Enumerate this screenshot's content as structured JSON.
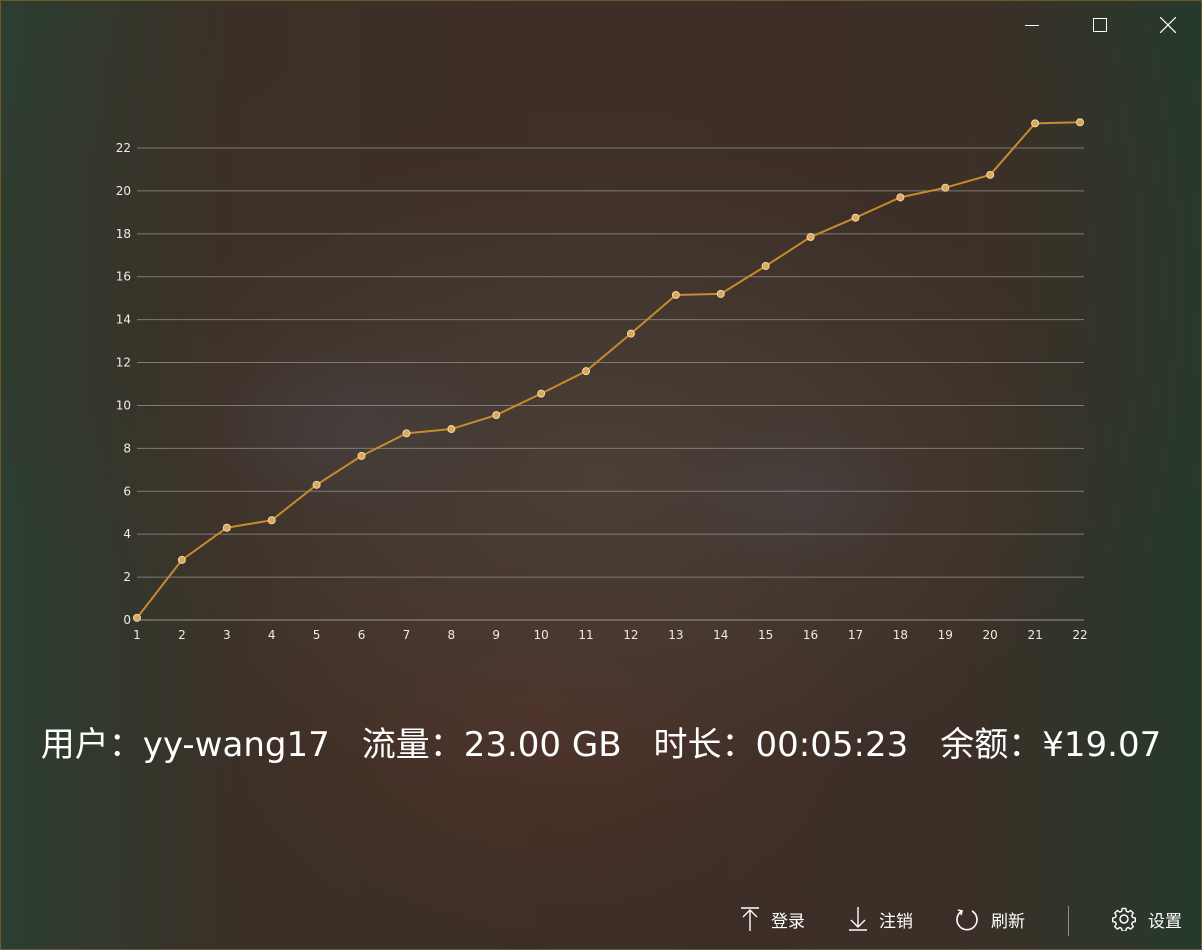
{
  "window_controls": {
    "minimize_icon": "minimize-icon",
    "maximize_icon": "maximize-icon",
    "close_icon": "close-icon"
  },
  "chart_data": {
    "type": "line",
    "x": [
      1,
      2,
      3,
      4,
      5,
      6,
      7,
      8,
      9,
      10,
      11,
      12,
      13,
      14,
      15,
      16,
      17,
      18,
      19,
      20,
      21,
      22
    ],
    "values": [
      0.1,
      2.8,
      4.3,
      4.65,
      6.3,
      7.65,
      8.7,
      8.9,
      9.55,
      10.55,
      11.6,
      13.35,
      15.15,
      15.2,
      16.5,
      17.85,
      18.75,
      19.7,
      20.15,
      20.75,
      23.15,
      23.2
    ],
    "xticks": [
      "1",
      "2",
      "3",
      "4",
      "5",
      "6",
      "7",
      "8",
      "9",
      "10",
      "11",
      "12",
      "13",
      "14",
      "15",
      "16",
      "17",
      "18",
      "19",
      "20",
      "21",
      "22"
    ],
    "yticks": [
      "0",
      "2",
      "4",
      "6",
      "8",
      "10",
      "12",
      "14",
      "16",
      "18",
      "20",
      "22"
    ],
    "ylim": [
      0,
      22
    ],
    "grid": true,
    "legend": "none",
    "line_color": "#c88a2e",
    "marker_fill": "#d9a85a"
  },
  "info": {
    "user": "用户：yy-wang17",
    "traffic": "流量：23.00 GB",
    "duration": "时长：00:05:23",
    "balance": "余额：¥19.07"
  },
  "toolbar": {
    "login_label": "登录",
    "logout_label": "注销",
    "refresh_label": "刷新",
    "settings_label": "设置",
    "login_icon": "arrow-up-icon",
    "logout_icon": "arrow-down-icon",
    "refresh_icon": "refresh-icon",
    "settings_icon": "gear-icon"
  }
}
